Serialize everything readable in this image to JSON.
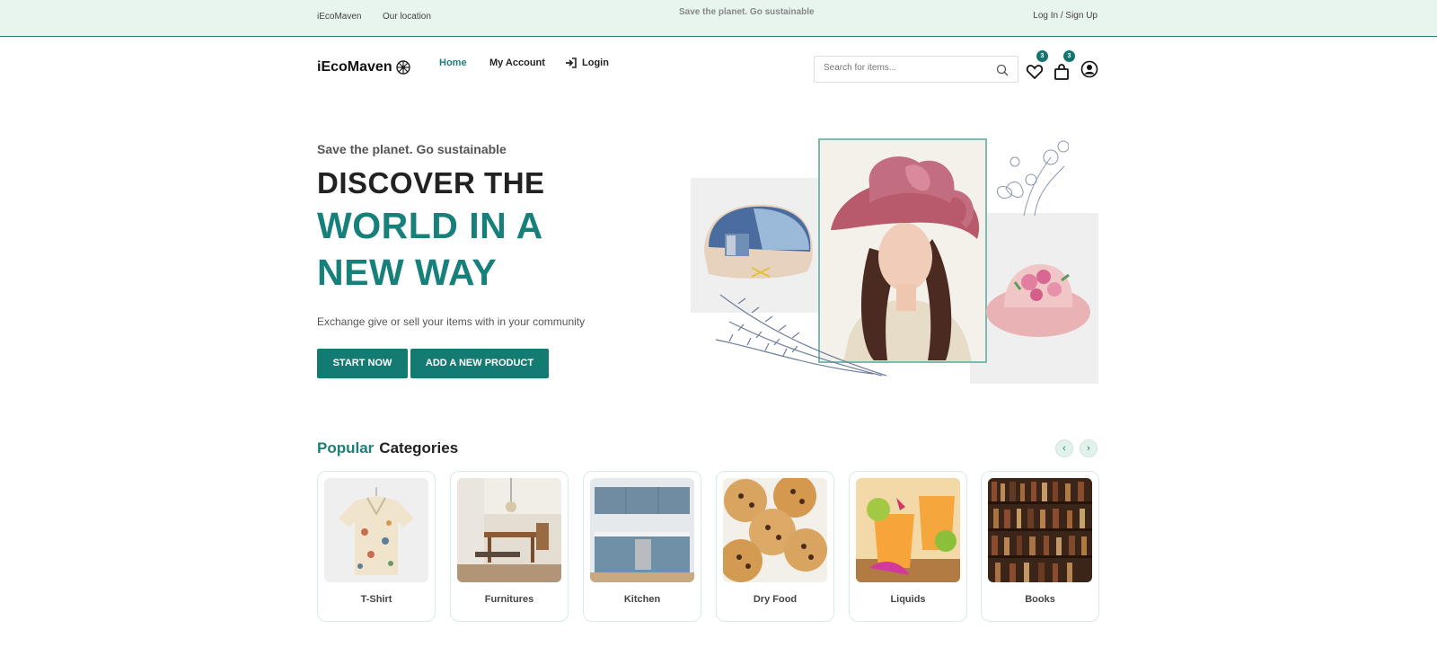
{
  "topbar": {
    "brand": "iEcoMaven",
    "location": "Our location",
    "tagline": "Save the planet. Go sustainable",
    "auth": "Log In / Sign Up"
  },
  "header": {
    "logo": "iEcoMaven",
    "nav": {
      "home": "Home",
      "account": "My Account",
      "login": "Login"
    },
    "search_placeholder": "Search for items...",
    "wishlist_count": "3",
    "cart_count": "3"
  },
  "hero": {
    "kicker": "Save the planet. Go sustainable",
    "line1": "DISCOVER THE",
    "line2": "WORLD IN A",
    "line3": "NEW WAY",
    "description": "Exchange give or sell your items with in your community",
    "start_label": "START NOW",
    "add_label": "ADD A NEW PRODUCT"
  },
  "categories": {
    "title_highlight": "Popular",
    "title_rest": "Categories",
    "items": [
      {
        "label": "T-Shirt"
      },
      {
        "label": "Furnitures"
      },
      {
        "label": "Kitchen"
      },
      {
        "label": "Dry Food"
      },
      {
        "label": "Liquids"
      },
      {
        "label": "Books"
      }
    ]
  },
  "colors": {
    "accent": "#18807a",
    "topbar": "#e8f4ee",
    "button": "#147b73"
  }
}
